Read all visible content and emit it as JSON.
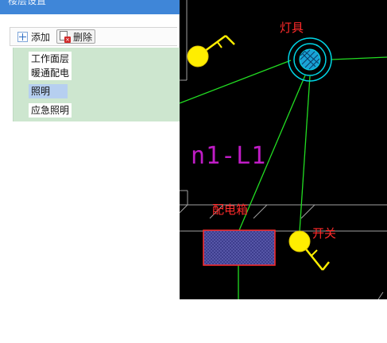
{
  "dialog": {
    "title": "楼层设置",
    "toolbar": {
      "add_label": "添加",
      "delete_label": "删除"
    },
    "floors": [
      {
        "label": "工作面层",
        "selected": false
      },
      {
        "label": "暖通配电",
        "selected": false
      },
      {
        "label": "照明",
        "selected": true
      },
      {
        "label": "应急照明",
        "selected": false
      }
    ]
  },
  "drawing": {
    "labels": {
      "fixture": "灯具",
      "distribution_box": "配电箱",
      "switch": "开关",
      "room": "n1-L1"
    },
    "colors": {
      "background": "#000000",
      "wire": "#22dd22",
      "wall": "#a0a0a0",
      "fixture": "#00d6e6",
      "switch": "#ffee00",
      "label": "#ff2a2a",
      "room_label": "#c01cc6",
      "distribution_box": "#3a3a8a"
    }
  }
}
